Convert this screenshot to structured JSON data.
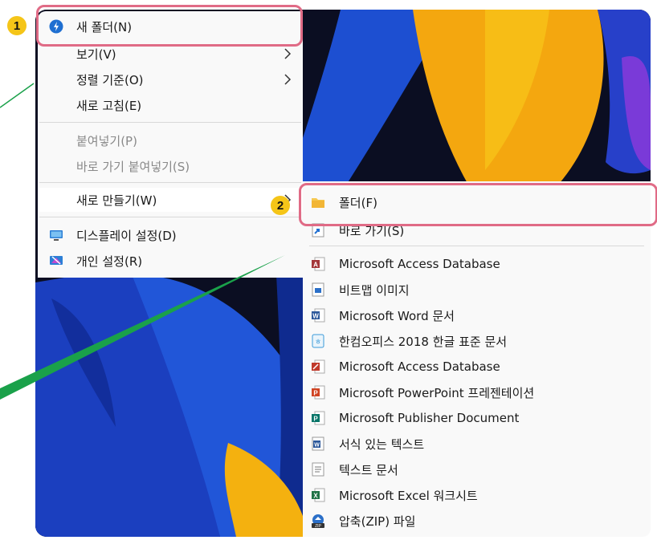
{
  "context_menu": {
    "items": [
      {
        "label": "새 폴더(N)",
        "icon": "new-folder-icon"
      },
      {
        "label": "보기(V)",
        "submenu": true
      },
      {
        "label": "정렬 기준(O)",
        "submenu": true
      },
      {
        "label": "새로 고침(E)"
      },
      {
        "label": "붙여넣기(P)",
        "disabled": true
      },
      {
        "label": "바로 가기 붙여넣기(S)",
        "disabled": true
      },
      {
        "label": "새로 만들기(W)",
        "submenu": true
      },
      {
        "label": "디스플레이 설정(D)",
        "icon": "display-icon"
      },
      {
        "label": "개인 설정(R)",
        "icon": "personalize-icon"
      }
    ]
  },
  "new_submenu": {
    "items": [
      {
        "label": "폴더(F)",
        "icon": "folder-icon"
      },
      {
        "label": "바로 가기(S)",
        "icon": "shortcut-icon"
      },
      {
        "label": "Microsoft Access Database",
        "icon": "access-icon"
      },
      {
        "label": "비트맵 이미지",
        "icon": "bitmap-icon"
      },
      {
        "label": "Microsoft Word 문서",
        "icon": "word-icon"
      },
      {
        "label": "한컴오피스 2018 한글 표준 문서",
        "icon": "hwp-icon"
      },
      {
        "label": "Microsoft Access Database",
        "icon": "access-icon"
      },
      {
        "label": "Microsoft PowerPoint 프레젠테이션",
        "icon": "powerpoint-icon"
      },
      {
        "label": "Microsoft Publisher Document",
        "icon": "publisher-icon"
      },
      {
        "label": "서식 있는 텍스트",
        "icon": "rtf-icon"
      },
      {
        "label": "텍스트 문서",
        "icon": "text-icon"
      },
      {
        "label": "Microsoft Excel 워크시트",
        "icon": "excel-icon"
      },
      {
        "label": "압축(ZIP) 파일",
        "icon": "zip-icon"
      }
    ]
  },
  "callouts": {
    "step1": "1",
    "step2": "2"
  },
  "colors": {
    "callout_border": "#e06b86",
    "badge": "#f5c518",
    "arrow_line": "#1aa14a",
    "menu_bg": "#f9f9f9"
  }
}
